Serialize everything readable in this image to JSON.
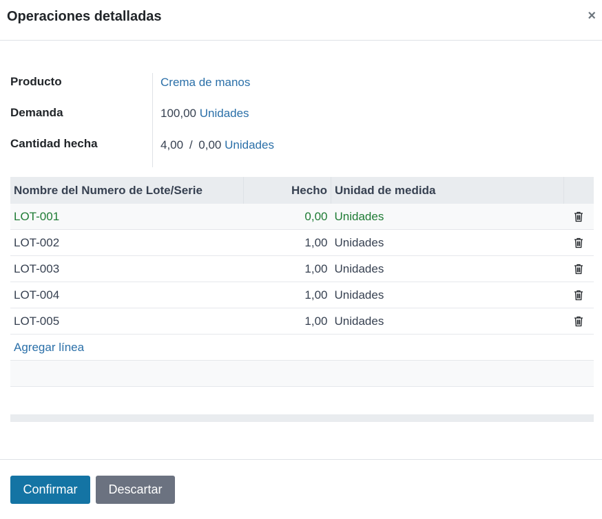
{
  "dialog": {
    "title": "Operaciones detalladas",
    "close_icon": "close-icon"
  },
  "fields": {
    "product_label": "Producto",
    "product_value": "Crema de manos",
    "demand_label": "Demanda",
    "demand_value": "100,00",
    "demand_uom": "Unidades",
    "qty_done_label": "Cantidad hecha",
    "qty_done_value": "4,00",
    "qty_separator": "/",
    "qty_reserved_value": "0,00",
    "qty_uom": "Unidades"
  },
  "table": {
    "headers": [
      "Nombre del Numero de Lote/Serie",
      "Hecho",
      "Unidad de medida",
      ""
    ],
    "rows": [
      {
        "lot": "LOT-001",
        "done": "0,00",
        "uom": "Unidades"
      },
      {
        "lot": "LOT-002",
        "done": "1,00",
        "uom": "Unidades"
      },
      {
        "lot": "LOT-003",
        "done": "1,00",
        "uom": "Unidades"
      },
      {
        "lot": "LOT-004",
        "done": "1,00",
        "uom": "Unidades"
      },
      {
        "lot": "LOT-005",
        "done": "1,00",
        "uom": "Unidades"
      }
    ],
    "add_line": "Agregar línea",
    "row_action_icon": "trash-icon"
  },
  "footer": {
    "confirm_label": "Confirmar",
    "discard_label": "Descartar"
  },
  "colors": {
    "primary": "#1474a4",
    "secondary": "#6b7280",
    "link": "#2a6fa8",
    "highlight_row": "#1e7b34"
  }
}
